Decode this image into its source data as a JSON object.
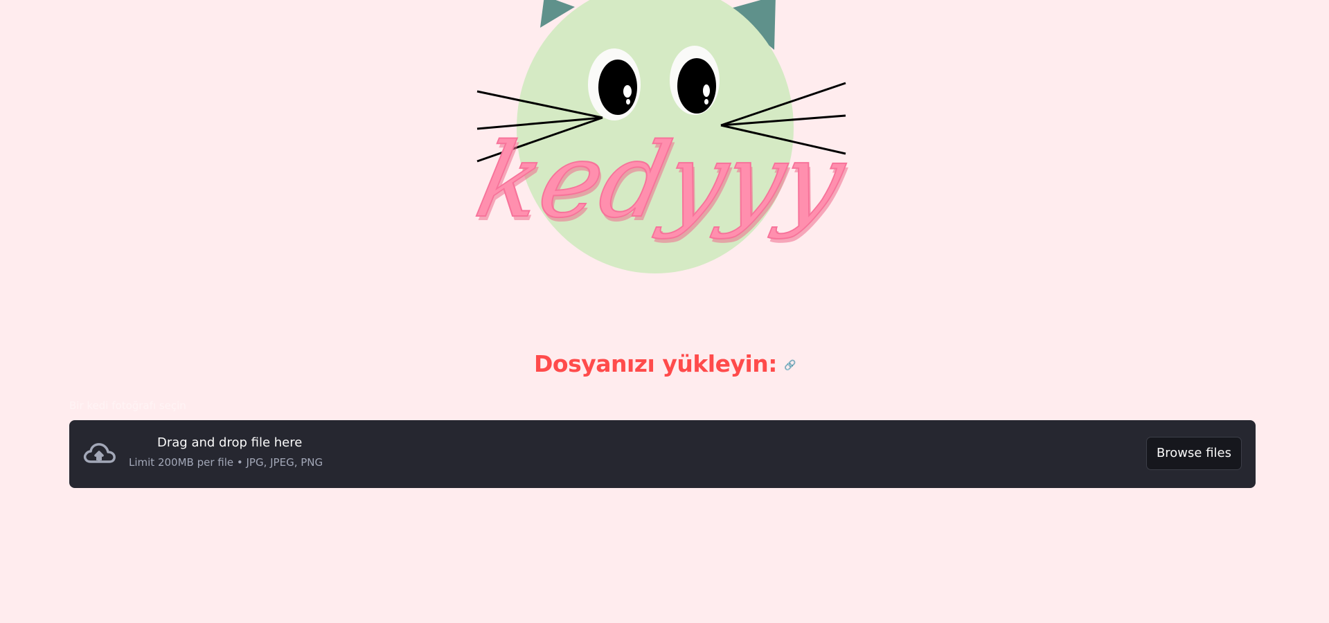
{
  "logo": {
    "wordmark": "kedyyy",
    "icon": "cat-face-logo",
    "colors": {
      "face": "#d5eac4",
      "ears": "#5f918b",
      "wordmark": "#ff8fae",
      "wordmark_shadow": "#f06d8f"
    }
  },
  "main": {
    "heading": "Dosyanızı yükleyin:",
    "heading_anchor_icon": "link-icon"
  },
  "uploader": {
    "label": "Bir kedi fotoğrafı seçin",
    "drag_text": "Drag and drop file here",
    "limit_text": "Limit 200MB per file • JPG, JPEG, PNG",
    "browse_label": "Browse files",
    "icon": "cloud-upload-icon"
  },
  "colors": {
    "background": "#ffecee",
    "accent": "#ff4b4b",
    "dropzone": "#262730"
  }
}
